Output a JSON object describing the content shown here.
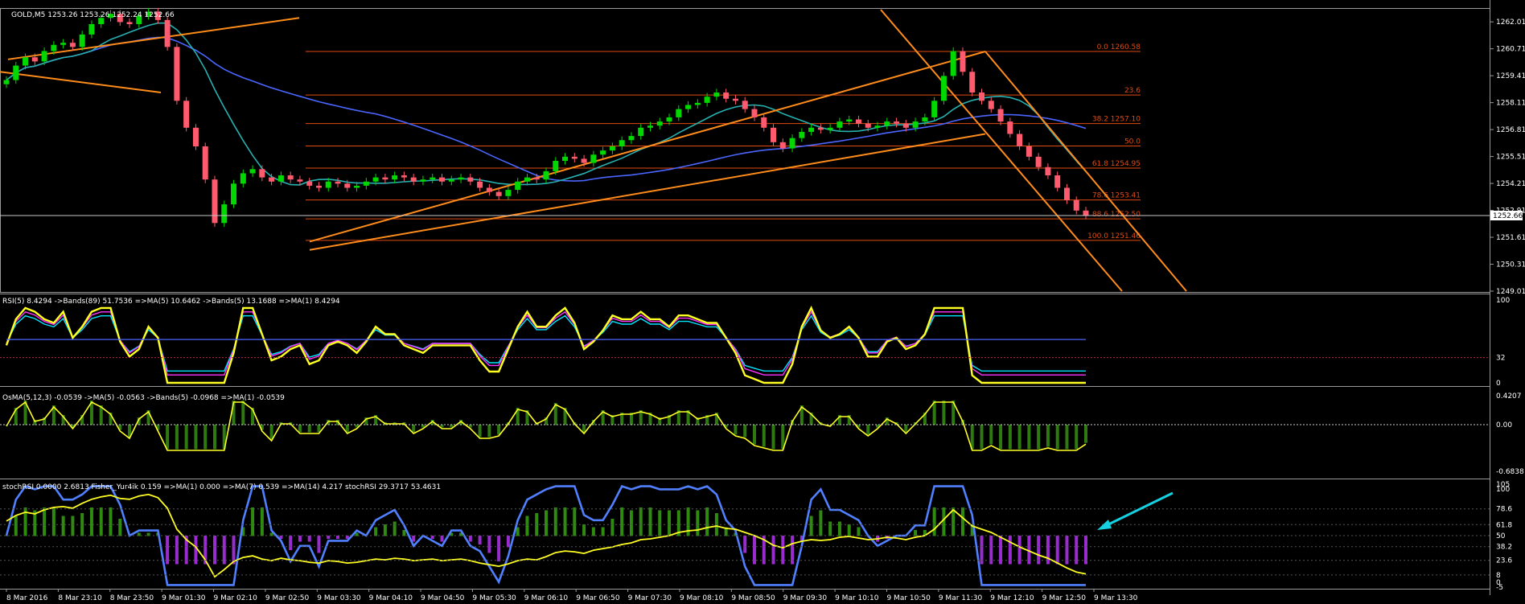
{
  "window": {
    "symbol_label": "GOLD,M5  1253.26 1253.26 1252.24 1252.66"
  },
  "current_price": "1252.66",
  "colors": {
    "background": "#000000",
    "bull_candle": "#00d800",
    "bear_candle": "#ff5a6e",
    "fib_line": "#e04a10",
    "trendline": "#ff8c1a",
    "ma_blue": "#4a66ff",
    "ma_teal": "#27b0b0",
    "rsi_yellow": "#ffff22",
    "rsi_cyan": "#00e5ff",
    "rsi_magenta": "#ff33ff",
    "stoch_blue": "#5080ff",
    "arrow_cyan": "#15d0e0"
  },
  "price_axis": {
    "ticks": [
      "1262.01",
      "1260.71",
      "1259.41",
      "1258.11",
      "1256.81",
      "1255.51",
      "1254.21",
      "1252.91",
      "1251.61",
      "1250.31",
      "1249.01"
    ]
  },
  "time_axis": {
    "ticks": [
      "8 Mar 2016",
      "8 Mar 23:10",
      "8 Mar 23:50",
      "9 Mar 01:30",
      "9 Mar 02:10",
      "9 Mar 02:50",
      "9 Mar 03:30",
      "9 Mar 04:10",
      "9 Mar 04:50",
      "9 Mar 05:30",
      "9 Mar 06:10",
      "9 Mar 06:50",
      "9 Mar 07:30",
      "9 Mar 08:10",
      "9 Mar 08:50",
      "9 Mar 09:30",
      "9 Mar 10:10",
      "9 Mar 10:50",
      "9 Mar 11:30",
      "9 Mar 12:10",
      "9 Mar 12:50",
      "9 Mar 13:30"
    ]
  },
  "fib_levels": [
    {
      "label": "0.0 1260.58",
      "price": 1260.58
    },
    {
      "label": "23.6",
      "price": 1258.48
    },
    {
      "label": "38.2 1257.10",
      "price": 1257.1
    },
    {
      "label": "50.0",
      "price": 1256.02
    },
    {
      "label": "61.8 1254.95",
      "price": 1254.95
    },
    {
      "label": "78.6 1253.41",
      "price": 1253.41
    },
    {
      "label": "88.6 1252.50",
      "price": 1252.5
    },
    {
      "label": "100.0 1251.46",
      "price": 1251.46
    }
  ],
  "indicators": {
    "rsi": {
      "label": "RSI(5) 8.4294  ->Bands(89) 51.7536  =>MA(5) 10.6462  ->Bands(5) 13.1688  =>MA(1) 8.4294",
      "ticks": [
        "100",
        "32",
        "0"
      ]
    },
    "osma": {
      "label": "OsMA(5,12,3) -0.0539  ->MA(5) -0.0563  ->Bands(5) -0.0968  =>MA(1) -0.0539",
      "ticks": [
        "0.4207",
        "0.00",
        "-0.6838"
      ]
    },
    "stoch": {
      "label": "stochRSI 0.0000 2.6813  Fisher_Yur4ik 0.159  =>MA(1) 0.000  =>MA(7) 0.539  =>MA(14) 4.217  stochRSI 29.3717 53.4631",
      "ticks": [
        "105",
        "100",
        "78.6",
        "61.8",
        "50",
        "38.2",
        "23.6",
        "8",
        "0",
        "-5"
      ]
    }
  },
  "chart_data": {
    "type": "candlestick",
    "timeframe": "M5",
    "y_range": [
      1249.01,
      1262.6
    ],
    "close_series": [
      1259.2,
      1259.9,
      1260.3,
      1260.1,
      1260.6,
      1260.9,
      1261.0,
      1260.8,
      1261.4,
      1261.9,
      1262.2,
      1262.4,
      1262.0,
      1261.9,
      1262.3,
      1262.5,
      1262.1,
      1260.8,
      1258.2,
      1256.9,
      1256.0,
      1254.4,
      1252.3,
      1253.2,
      1254.2,
      1254.7,
      1254.9,
      1254.5,
      1254.3,
      1254.6,
      1254.4,
      1254.3,
      1254.1,
      1254.0,
      1254.3,
      1254.2,
      1254.0,
      1254.1,
      1254.3,
      1254.5,
      1254.4,
      1254.6,
      1254.5,
      1254.3,
      1254.4,
      1254.5,
      1254.3,
      1254.4,
      1254.5,
      1254.3,
      1254.0,
      1253.8,
      1253.6,
      1253.9,
      1254.3,
      1254.5,
      1254.4,
      1254.8,
      1255.3,
      1255.5,
      1255.4,
      1255.2,
      1255.6,
      1255.8,
      1256.0,
      1256.3,
      1256.5,
      1256.9,
      1257.0,
      1257.2,
      1257.4,
      1257.8,
      1258.0,
      1258.1,
      1258.4,
      1258.6,
      1258.3,
      1258.2,
      1257.8,
      1257.4,
      1256.9,
      1256.2,
      1255.9,
      1256.4,
      1256.7,
      1256.9,
      1256.8,
      1256.9,
      1257.2,
      1257.3,
      1257.1,
      1256.9,
      1257.0,
      1257.2,
      1257.1,
      1256.9,
      1257.2,
      1257.4,
      1258.2,
      1259.4,
      1260.6,
      1259.6,
      1258.6,
      1258.2,
      1257.8,
      1257.2,
      1256.6,
      1256.0,
      1255.5,
      1255.0,
      1254.6,
      1254.0,
      1253.4,
      1252.9,
      1252.66
    ]
  }
}
